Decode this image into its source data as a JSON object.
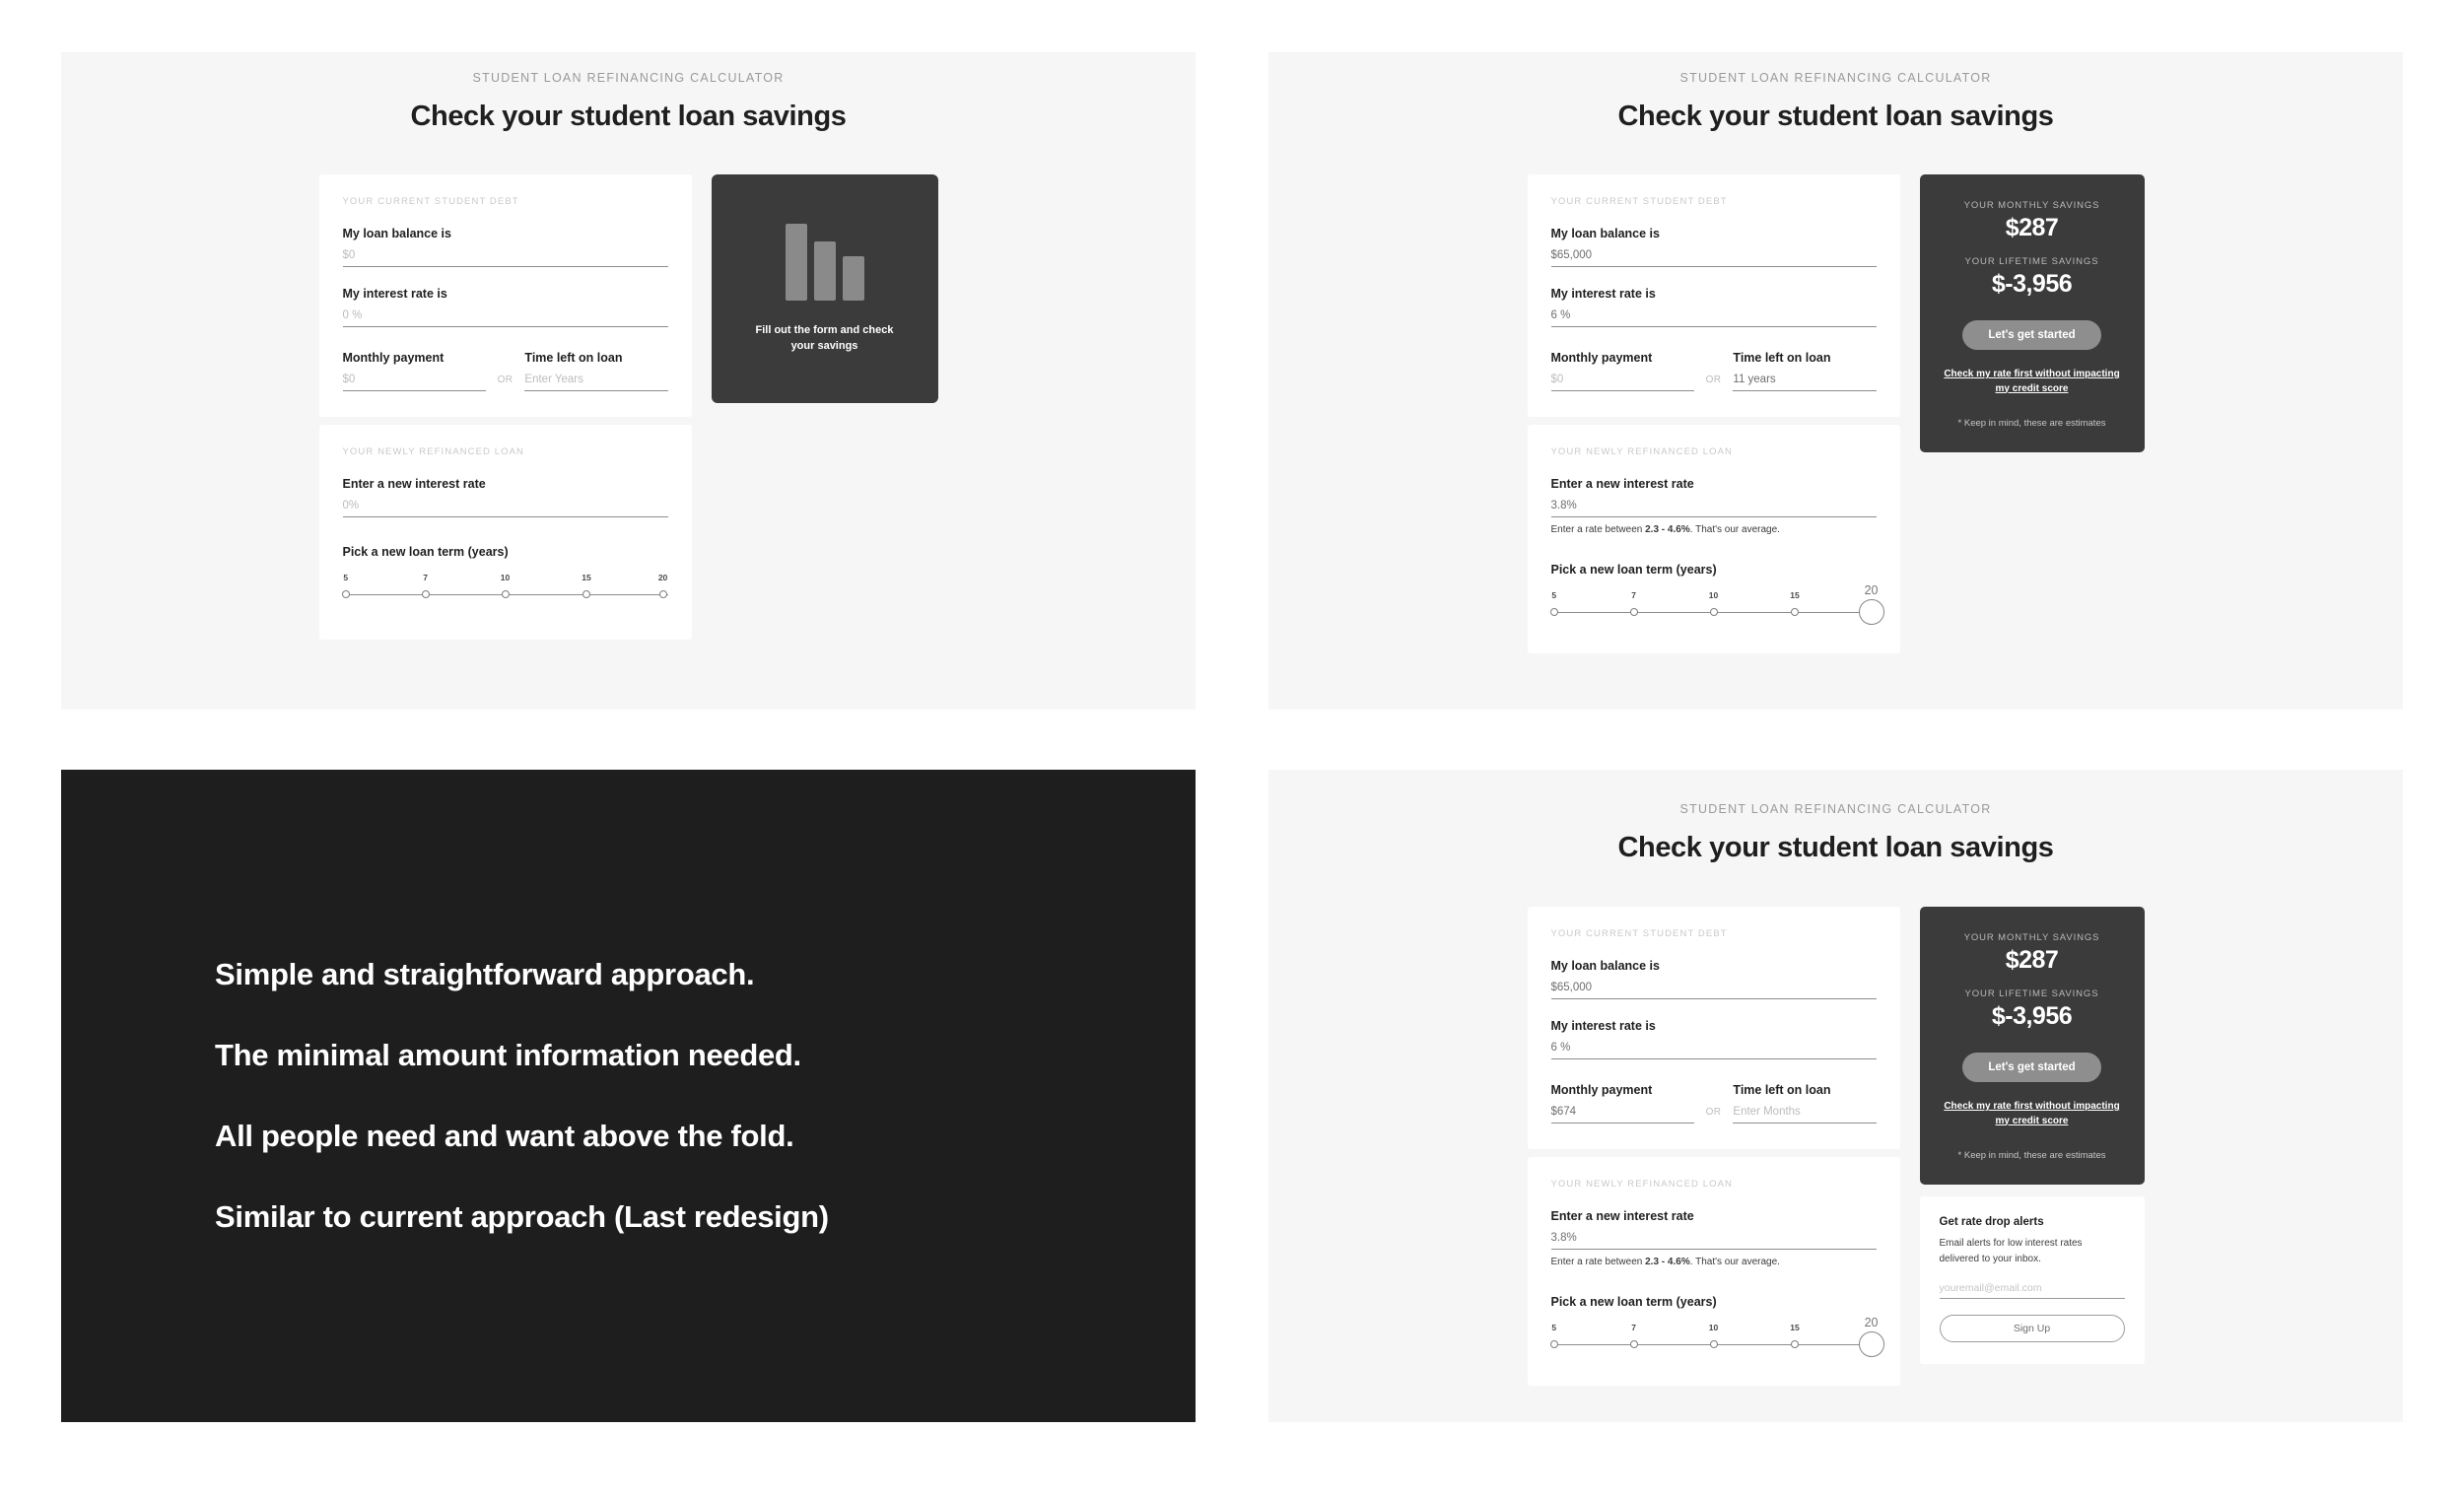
{
  "colors": {
    "panel_bg": "#f6f6f6",
    "card_bg": "#ffffff",
    "dark_card": "#3b3b3b",
    "dark_panel": "#1e1e1e",
    "cta": "#8e8e8e",
    "muted_text": "#bcbcbc"
  },
  "calculator": {
    "eyebrow": "STUDENT LOAN REFINANCING CALCULATOR",
    "headline": "Check your student loan savings",
    "current_debt_label": "YOUR CURRENT STUDENT DEBT",
    "refinanced_label": "YOUR NEWLY REFINANCED LOAN",
    "fields": {
      "balance_label": "My loan balance is",
      "rate_label": "My interest rate is",
      "monthly_label": "Monthly payment",
      "time_label": "Time left on loan",
      "or": "OR",
      "new_rate_label": "Enter a new interest rate",
      "term_label": "Pick a new loan term (years)"
    },
    "rate_helper": {
      "prefix": "Enter a rate between ",
      "range": "2.3 - 4.6%",
      "suffix": ". That's our average."
    },
    "slider_ticks": [
      "5",
      "7",
      "10",
      "15",
      "20"
    ]
  },
  "state_empty": {
    "balance_value": "$0",
    "rate_value": "0 %",
    "monthly_value": "$0",
    "time_value": "Enter Years",
    "new_rate_value": "0%",
    "selected_term": null
  },
  "state_filled_years": {
    "balance_value": "$65,000",
    "rate_value": "6 %",
    "monthly_value": "$0",
    "time_value": "11 years",
    "new_rate_value": "3.8%",
    "selected_term": "20"
  },
  "state_filled_months": {
    "balance_value": "$65,000",
    "rate_value": "6 %",
    "monthly_value": "$674",
    "time_value": "Enter Months",
    "new_rate_value": "3.8%",
    "selected_term": "20"
  },
  "empty_chart_card": {
    "caption": "Fill out the form and check your savings",
    "bar_heights": [
      78,
      60,
      45
    ]
  },
  "results": {
    "monthly_label": "YOUR MONTHLY SAVINGS",
    "monthly_value": "$287",
    "lifetime_label": "YOUR LIFETIME SAVINGS",
    "lifetime_value": "$-3,956",
    "cta_label": "Let's get started",
    "secondary_link": "Check my rate first without impacting my credit score",
    "disclaimer": "* Keep in mind, these are estimates"
  },
  "promo": {
    "title": "Get rate drop alerts",
    "text": "Email alerts for low interest rates delivered to your inbox.",
    "email_placeholder": "youremail@email.com",
    "button_label": "Sign Up"
  },
  "statements": {
    "line1": "Simple and straightforward approach.",
    "line2": "The minimal amount information needed.",
    "line3": "All people need and want above the fold.",
    "line4": "Similar to current approach (Last redesign)"
  }
}
